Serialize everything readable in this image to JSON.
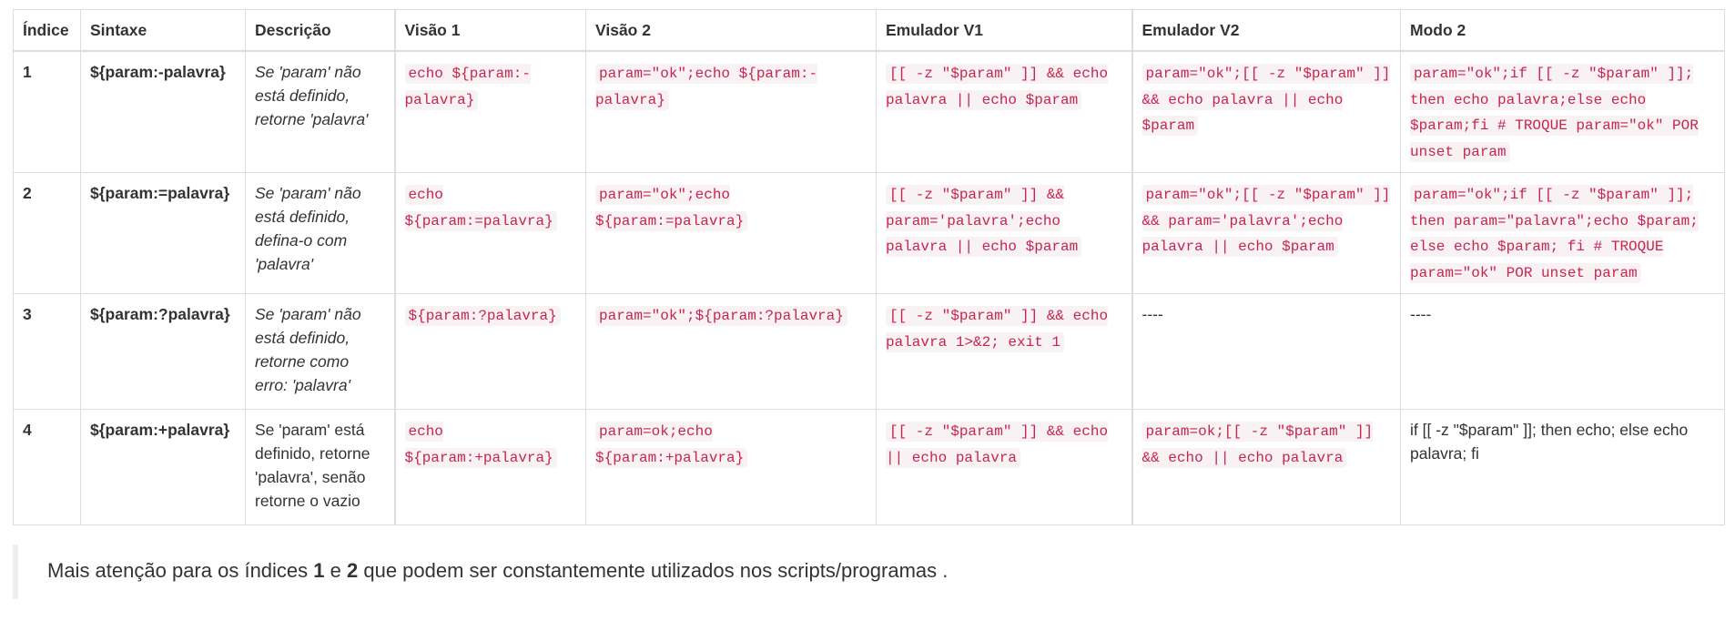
{
  "headers": [
    "Índice",
    "Sintaxe",
    "Descrição",
    "Visão 1",
    "Visão 2",
    "Emulador V1",
    "Emulador V2",
    "Modo 2"
  ],
  "rows": [
    {
      "index": "1",
      "syntax": "${param:-palavra}",
      "description": "Se 'param' não está definido, retorne 'palavra'",
      "visao1": "echo ${param:-palavra}",
      "visao2": "param=\"ok\";echo ${param:-palavra}",
      "emu_v1": "[[ -z \"$param\" ]] && echo palavra || echo $param",
      "emu_v2": "param=\"ok\";[[ -z \"$param\" ]] && echo palavra || echo $param",
      "modo2": "param=\"ok\";if [[ -z \"$param\" ]]; then echo palavra;else echo $param;fi # TROQUE param=\"ok\" POR unset param"
    },
    {
      "index": "2",
      "syntax": "${param:=palavra}",
      "description": "Se 'param' não está definido, defina-o com 'palavra'",
      "visao1": "echo ${param:=palavra}",
      "visao2": "param=\"ok\";echo ${param:=palavra}",
      "emu_v1": "[[ -z \"$param\" ]] && param='palavra';echo palavra || echo $param",
      "emu_v2": "param=\"ok\";[[ -z \"$param\" ]] && param='palavra';echo palavra || echo $param",
      "modo2": "param=\"ok\";if [[ -z \"$param\" ]]; then param=\"palavra\";echo $param; else echo $param; fi # TROQUE param=\"ok\" POR unset param"
    },
    {
      "index": "3",
      "syntax": "${param:?palavra}",
      "description": "Se 'param' não está definido, retorne como erro: 'palavra'",
      "visao1": "${param:?palavra}",
      "visao2": "param=\"ok\";${param:?palavra}",
      "emu_v1": "[[ -z \"$param\" ]] && echo palavra 1>&2; exit 1",
      "emu_v2": "----",
      "modo2": "----"
    },
    {
      "index": "4",
      "syntax": "${param:+palavra}",
      "description": "Se 'param' está definido, retorne 'palavra', senão retorne o vazio",
      "visao1": "echo ${param:+palavra}",
      "visao2": "param=ok;echo ${param:+palavra}",
      "emu_v1": "[[ -z \"$param\" ]] && echo || echo palavra",
      "emu_v2": "param=ok;[[ -z \"$param\" ]] && echo || echo palavra",
      "modo2": "if [[ -z \"$param\" ]]; then echo; else echo palavra; fi"
    }
  ],
  "note": {
    "prefix": "Mais atenção para os índices ",
    "first": "1",
    "middle": " e ",
    "second": "2",
    "suffix": " que podem ser constantemente utilizados nos scripts/programas ."
  },
  "colors": {
    "code_text": "#c7254e",
    "code_bg": "#f9f2f4",
    "border": "#dddddd",
    "text": "#333333"
  }
}
